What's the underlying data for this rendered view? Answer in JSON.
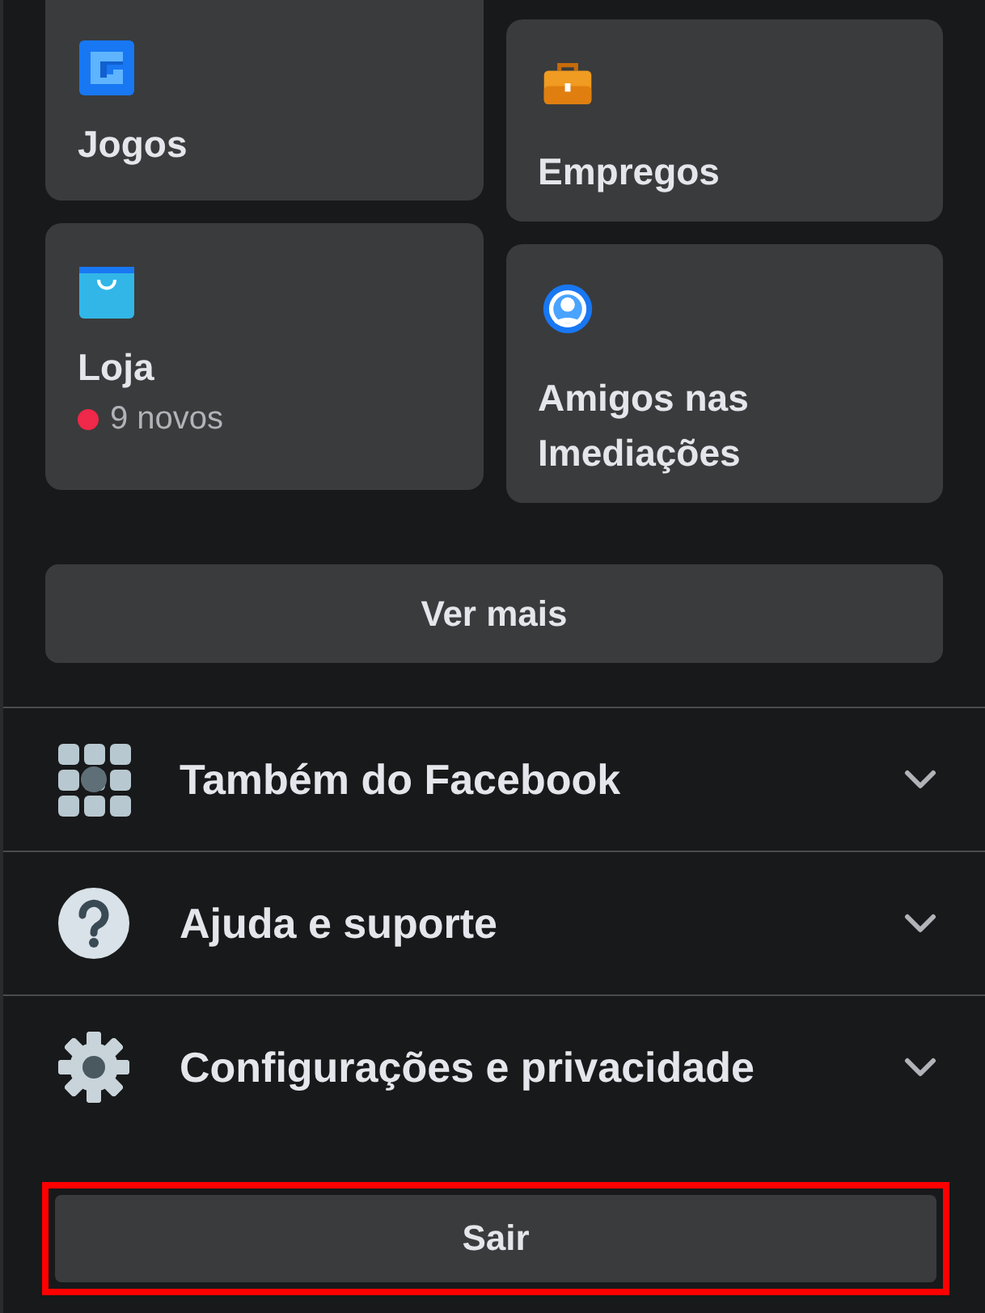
{
  "shortcut_columns": [
    [
      {
        "label": "Jogos",
        "kind": "games"
      },
      {
        "label": "Loja",
        "kind": "shop",
        "badge": {
          "text": "9 novos",
          "color": "#f02849"
        }
      }
    ],
    [
      {
        "label": "Empregos",
        "kind": "jobs"
      },
      {
        "label": "Amigos nas Imediações",
        "kind": "nearby"
      }
    ]
  ],
  "see_more": "Ver mais",
  "sections": [
    {
      "label": "Também do Facebook",
      "kind": "apps",
      "expanded": false
    },
    {
      "label": "Ajuda e suporte",
      "kind": "help",
      "expanded": false
    },
    {
      "label": "Configurações e privacidade",
      "kind": "settings",
      "expanded": false
    }
  ],
  "logout": {
    "label": "Sair",
    "highlighted": true
  }
}
